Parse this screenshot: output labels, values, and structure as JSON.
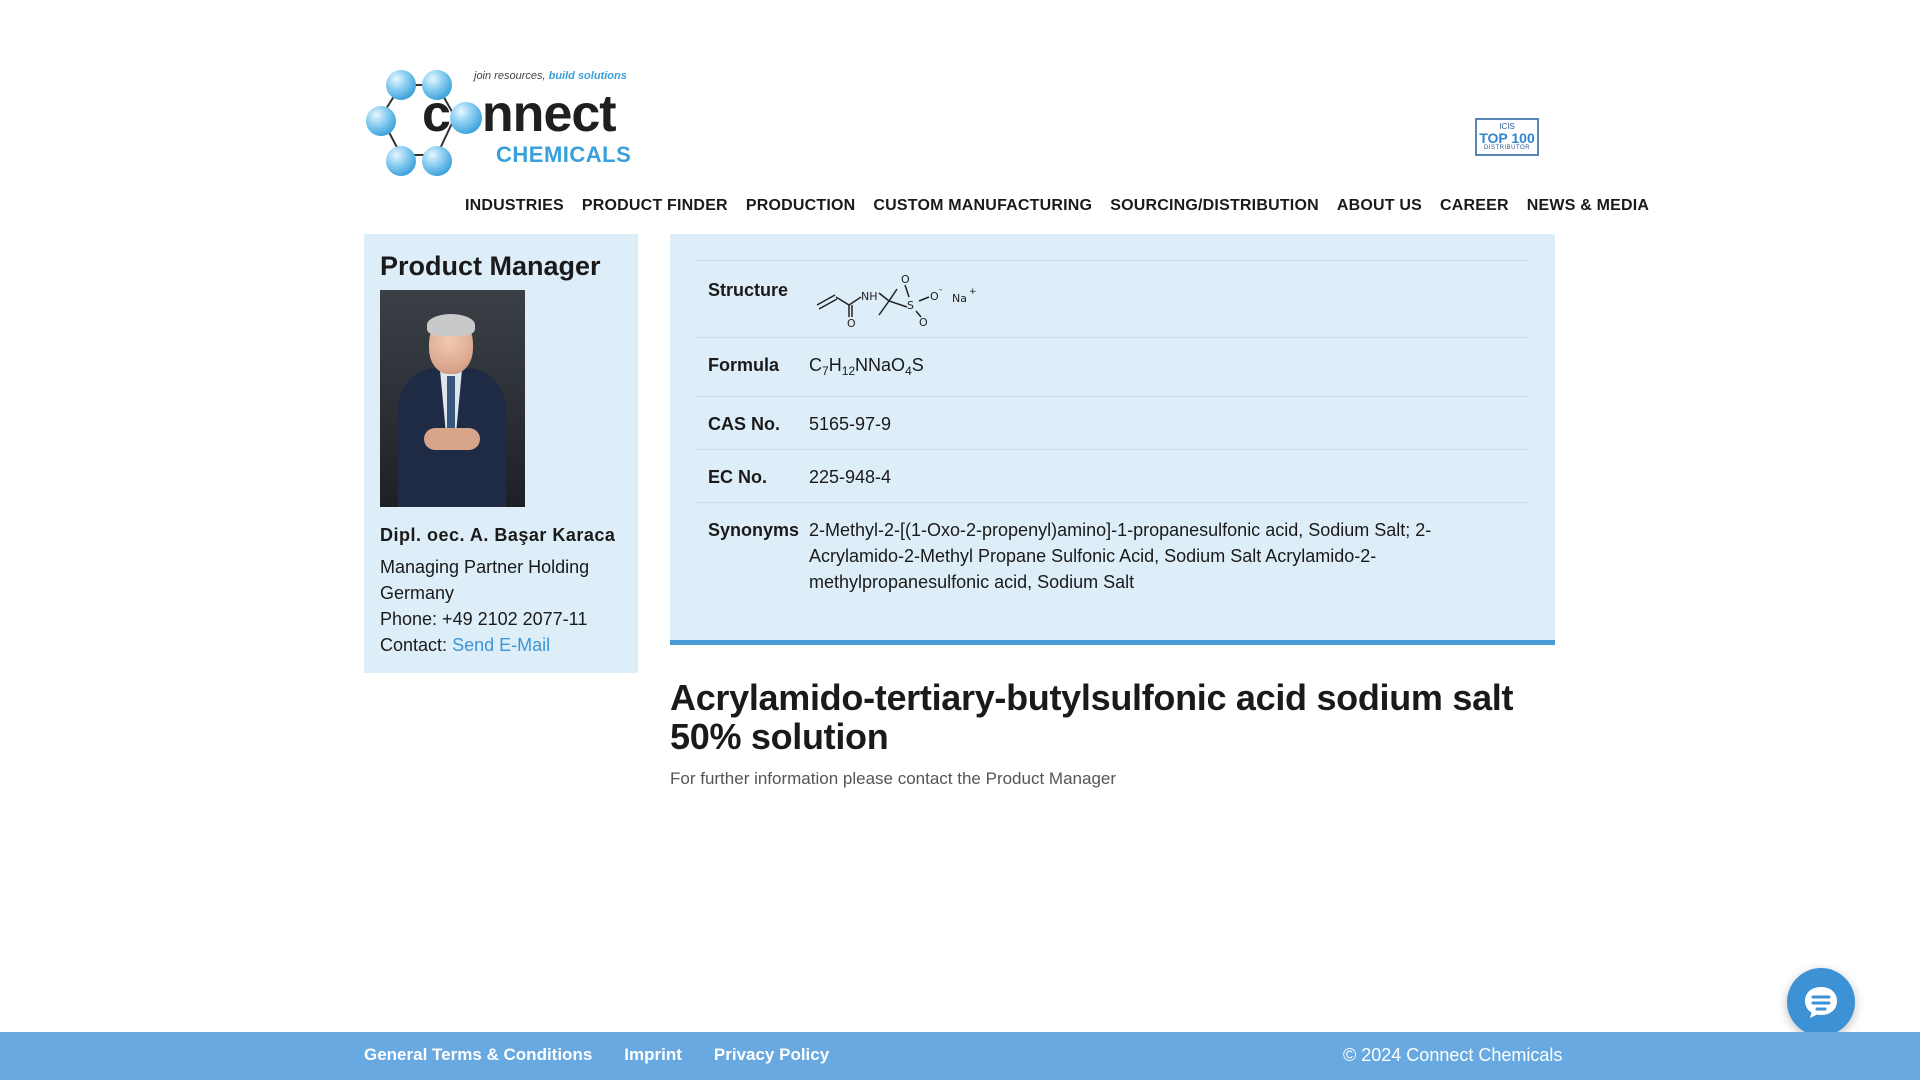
{
  "header": {
    "logo": {
      "tagline_plain": "join resources,",
      "tagline_accent": "build solutions",
      "word_c": "c",
      "word_rest": "nnect",
      "subword": "CHEMICALS"
    },
    "badge": {
      "line1": "ICIS",
      "line2": "TOP 100",
      "line3": "DISTRIBUTOR"
    },
    "nav": [
      "INDUSTRIES",
      "PRODUCT FINDER",
      "PRODUCTION",
      "CUSTOM MANUFACTURING",
      "SOURCING/DISTRIBUTION",
      "ABOUT US",
      "CAREER",
      "NEWS & MEDIA"
    ]
  },
  "sidebar": {
    "title": "Product Manager",
    "name": "Dipl. oec. A. Başar Karaca",
    "role_line1": "Managing Partner Holding",
    "role_line2": "Germany",
    "phone": "Phone: +49 2102 2077-11",
    "contact_label": "Contact:",
    "contact_link": "Send E-Mail"
  },
  "product": {
    "labels": {
      "structure": "Structure",
      "formula": "Formula",
      "cas": "CAS No.",
      "ec": "EC No.",
      "synonyms": "Synonyms"
    },
    "structure_text": {
      "nh": "NH",
      "s": "S",
      "o": "O",
      "o_minus": "O",
      "minus": "-",
      "na": "Na",
      "plus": "+"
    },
    "formula": {
      "c": "C",
      "c_n": "7",
      "h": "H",
      "h_n": "12",
      "nnao": "NNaO",
      "o_n": "4",
      "s": "S"
    },
    "cas": "5165-97-9",
    "ec": "225-948-4",
    "synonyms": "2-Methyl-2-[(1-Oxo-2-propenyl)amino]-1-propanesulfonic acid, Sodium Salt; 2-Acrylamido-2-Methyl Propane Sulfonic Acid, Sodium Salt Acrylamido-2-methylpropanesulfonic acid, Sodium Salt",
    "title": "Acrylamido-tertiary-butylsulfonic acid sodium salt 50% solution",
    "note": "For further information please contact the Product Manager"
  },
  "footer": {
    "links": [
      "General Terms & Conditions",
      "Imprint",
      "Privacy Policy"
    ],
    "copyright": "© 2024 Connect Chemicals"
  },
  "colors": {
    "accent": "#3aa0dc",
    "panel_bg": "#deeef8",
    "footer_bg": "#67a9e0",
    "panel_border": "#4a9ad6"
  },
  "icons": {
    "logo": "molecule-ring-logo",
    "badge": "icis-top100-badge",
    "chat": "chat-bubble-icon"
  }
}
